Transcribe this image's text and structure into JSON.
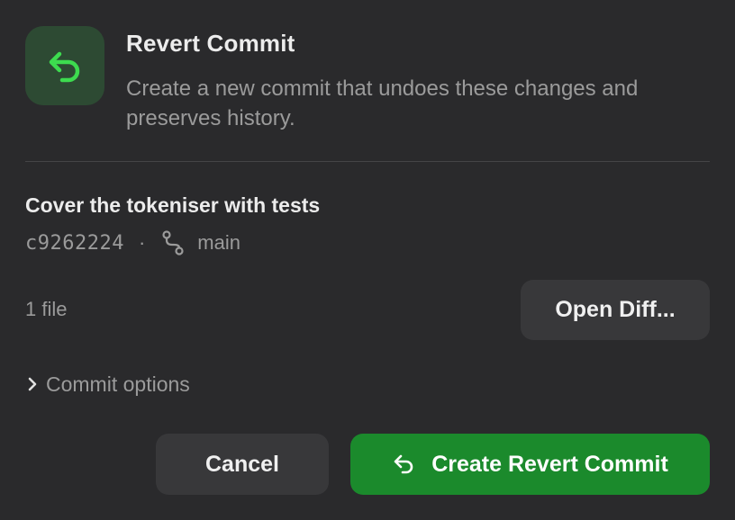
{
  "dialog": {
    "title": "Revert Commit",
    "description": "Create a new commit that undoes these changes and preserves history.",
    "icon": "revert-arrow-icon",
    "accent_color": "#2ecc40"
  },
  "commit": {
    "message": "Cover the tokeniser with tests",
    "hash": "c9262224",
    "separator": "·",
    "branch_icon": "branch-icon",
    "branch": "main"
  },
  "files": {
    "count_label": "1 file",
    "open_diff_label": "Open Diff..."
  },
  "options": {
    "toggle_label": "Commit options",
    "expanded": false
  },
  "actions": {
    "cancel_label": "Cancel",
    "confirm_label": "Create Revert Commit",
    "confirm_color": "#1b8a2c"
  }
}
